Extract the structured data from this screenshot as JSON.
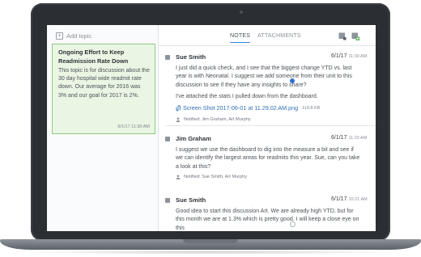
{
  "left_pane": {
    "add_topic_label": "Add topic",
    "topic": {
      "title": "Ongoing Effort to Keep Readmission Rate Down",
      "body": "This topic is for discussion about the 30 day hospital wide readmit rate down. Our average for 2016 was 3% and our goal for 2017 is 2%.",
      "time": "6/1/17 11:30 AM"
    }
  },
  "tabs": [
    {
      "label": "NOTES",
      "active": true
    },
    {
      "label": "ATTACHMENTS",
      "active": false
    }
  ],
  "toolbar": {
    "note_icon": "note-icon",
    "add_note_icon": "add-note-icon"
  },
  "notes": [
    {
      "author": "Sue Smith",
      "date": "6/1/17",
      "time": "11:30 AM",
      "body": "I just did a quick check, and I see that the biggest change YTD vs. last year is with Neonatal. I suggest we add someone from their unit to this discussion to see if they have any insights to share?",
      "body2": "I've attached the stats I pulled down from the dashboard.",
      "attachment": {
        "name": "Screen Shot 2017-06-01 at 11.29.02 AM.png",
        "size": "119.8 KB"
      },
      "notified": "Notified: Jim Graham, Art Murphy"
    },
    {
      "author": "Jim Graham",
      "date": "6/1/17",
      "time": "11:22 AM",
      "body": "I suggest we use the dashboard to dig into the measure a bit and see if we can identify the largest areas for readmits this year. Sue, can you take a look at this?",
      "notified": "Notified: Sue Smith, Art Murphy"
    },
    {
      "author": "Sue Smith",
      "date": "6/1/17",
      "time": "10:21 AM",
      "body": "Good idea to start this discussion Art. We are already high YTD, but for this month we are at 1.3% which is pretty good. I will keep a close eye on this"
    }
  ],
  "colors": {
    "accent": "#3d86d6",
    "topic_card_bg": "#eaf6e4",
    "topic_card_border": "#8fcb7e",
    "unread_dot": "#2f6fd6",
    "frame": "#2b2f34"
  }
}
